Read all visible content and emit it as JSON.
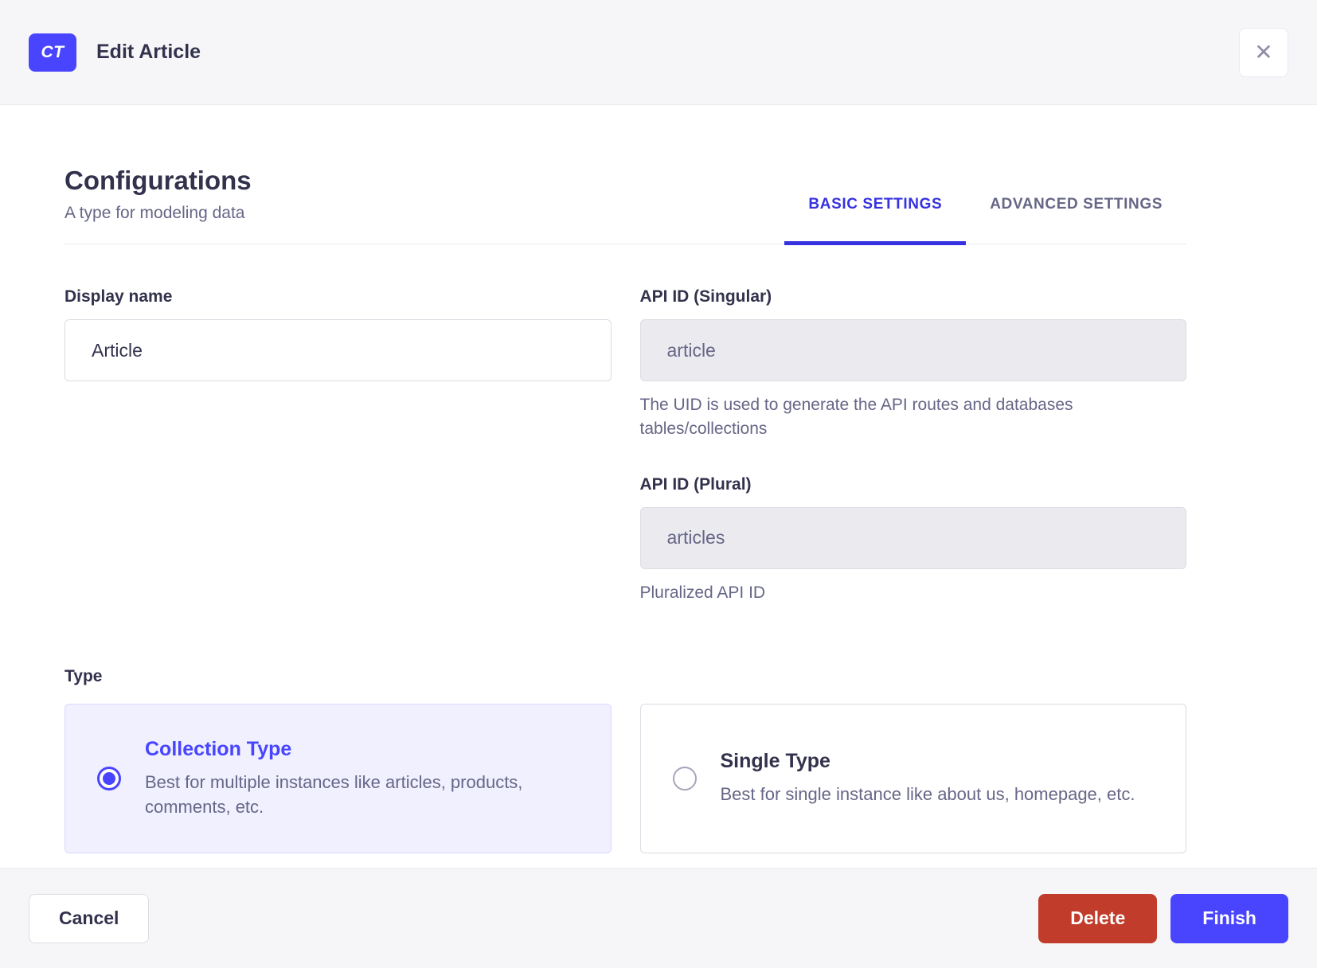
{
  "header": {
    "badge": "CT",
    "title": "Edit Article"
  },
  "config": {
    "title": "Configurations",
    "subtitle": "A type for modeling data",
    "tabs": [
      {
        "label": "BASIC SETTINGS",
        "active": true
      },
      {
        "label": "ADVANCED SETTINGS",
        "active": false
      }
    ]
  },
  "fields": {
    "display_name": {
      "label": "Display name",
      "value": "Article"
    },
    "api_id_singular": {
      "label": "API ID (Singular)",
      "value": "article",
      "hint": "The UID is used to generate the API routes and databases tables/collections",
      "disabled": true
    },
    "api_id_plural": {
      "label": "API ID (Plural)",
      "value": "articles",
      "hint": "Pluralized API ID",
      "disabled": true
    }
  },
  "type": {
    "label": "Type",
    "options": [
      {
        "title": "Collection Type",
        "description": "Best for multiple instances like articles, products, comments, etc.",
        "selected": true
      },
      {
        "title": "Single Type",
        "description": "Best for single instance like about us, homepage, etc.",
        "selected": false
      }
    ]
  },
  "footer": {
    "cancel_label": "Cancel",
    "delete_label": "Delete",
    "finish_label": "Finish"
  },
  "icons": {
    "close": "✕"
  },
  "colors": {
    "primary": "#4945ff",
    "tab_active": "#3632e0",
    "danger": "#c23c2b",
    "selected_card_bg": "#f0f0ff",
    "selected_card_border": "#d9d8ff",
    "surface_gray": "#f6f6f9",
    "border_gray": "#eaeaef",
    "input_border": "#dcdce4",
    "disabled_input_bg": "#eaeaef",
    "text_dark": "#32324d",
    "text_muted": "#666687"
  }
}
